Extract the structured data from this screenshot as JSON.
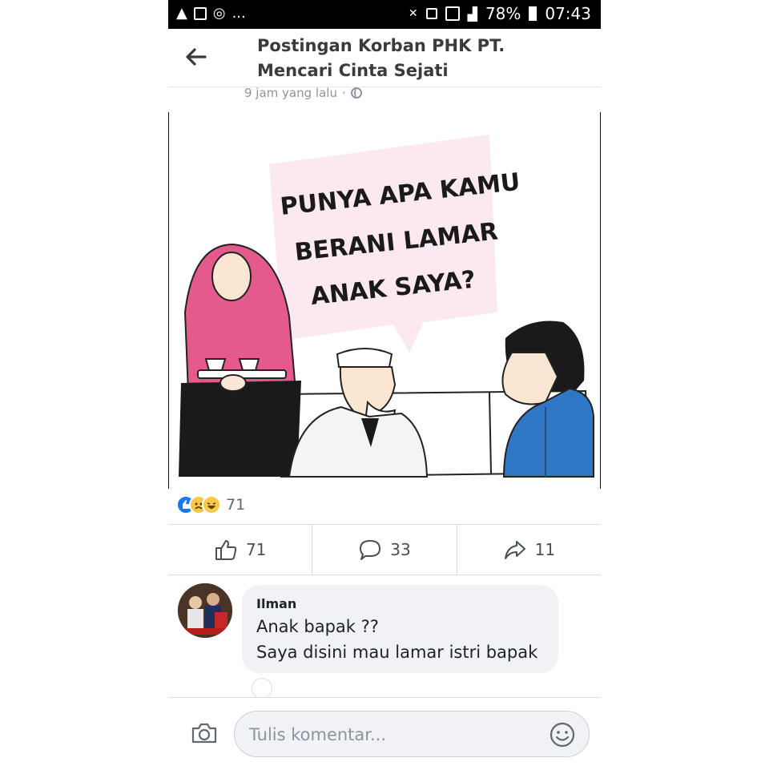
{
  "status_bar": {
    "left_icons": [
      "warning-icon",
      "gallery-icon",
      "instagram-icon"
    ],
    "left_more": "...",
    "battery": "78%",
    "time": "07:43"
  },
  "header": {
    "title": "Postingan Korban PHK PT. Mencari Cinta Sejati"
  },
  "post": {
    "time": "9 jam yang lalu",
    "separator": "·",
    "image_text_lines": [
      "PUNYA APA KAMU",
      "BERANI LAMAR",
      "ANAK SAYA?"
    ],
    "reaction_count": "71",
    "actions": {
      "like": "71",
      "comment": "33",
      "share": "11"
    }
  },
  "comment": {
    "name": "Ilman",
    "line1": "Anak bapak ??",
    "line2": "Saya disini mau lamar istri bapak"
  },
  "composer": {
    "placeholder": "Tulis komentar..."
  },
  "colors": {
    "accent": "#1877f2",
    "hijab_pink": "#e55a8c",
    "shirt_blue": "#2f77c5"
  }
}
